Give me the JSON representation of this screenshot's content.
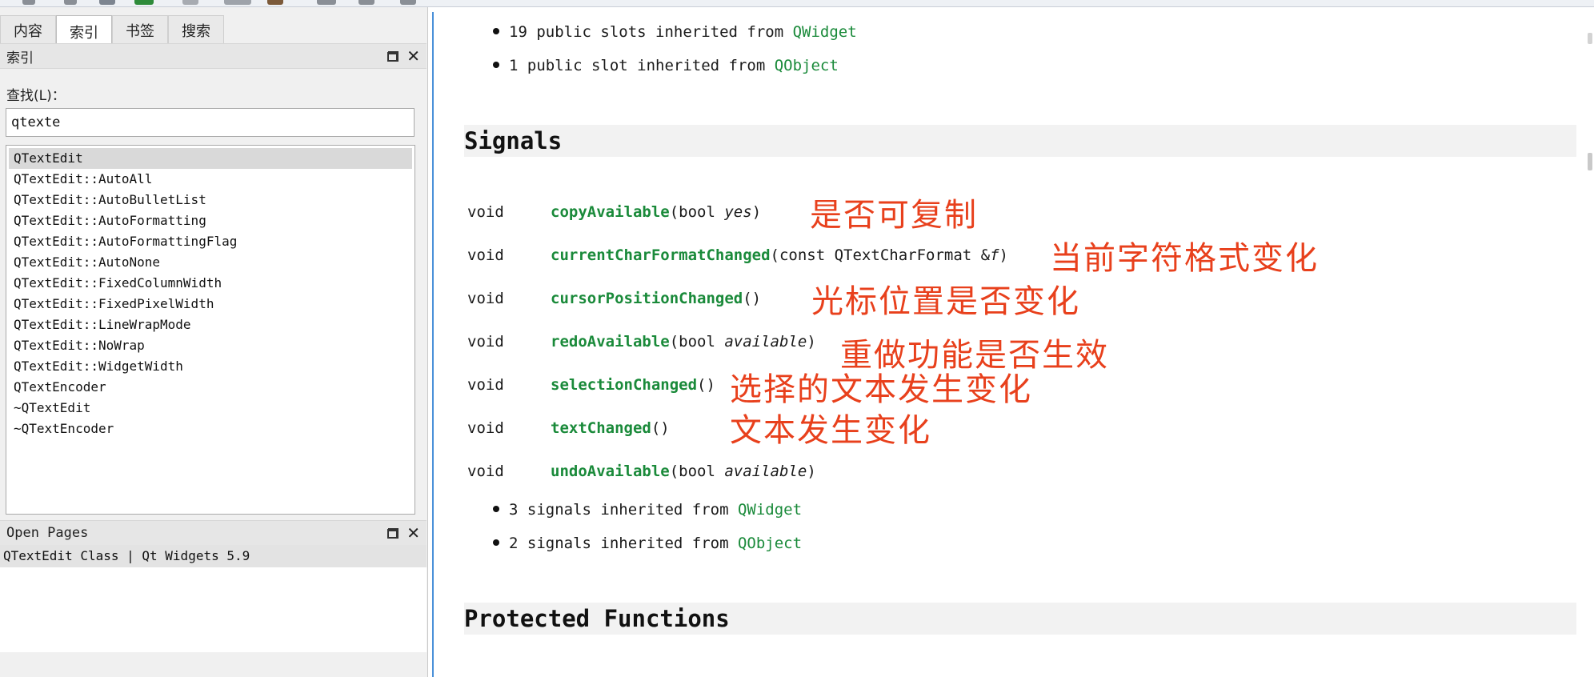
{
  "toolbar": {
    "icons": [
      "back-icon",
      "forward-icon",
      "home-icon",
      "sync-icon",
      "bookmark-icon",
      "print-icon",
      "zoom-in-icon",
      "zoom-out-icon",
      "zoom-reset-icon"
    ]
  },
  "left": {
    "tabs": [
      "内容",
      "索引",
      "书签",
      "搜索"
    ],
    "active_tab": "索引",
    "index_dock_title": "索引",
    "find_label": "查找(L)：",
    "search_value": "qtexte",
    "index_items": [
      "QTextEdit",
      "QTextEdit::AutoAll",
      "QTextEdit::AutoBulletList",
      "QTextEdit::AutoFormatting",
      "QTextEdit::AutoFormattingFlag",
      "QTextEdit::AutoNone",
      "QTextEdit::FixedColumnWidth",
      "QTextEdit::FixedPixelWidth",
      "QTextEdit::LineWrapMode",
      "QTextEdit::NoWrap",
      "QTextEdit::WidgetWidth",
      "QTextEncoder",
      "~QTextEdit",
      "~QTextEncoder"
    ],
    "selected_index": 0,
    "open_pages_title": "Open Pages",
    "open_page_item": "QTextEdit Class | Qt Widgets 5.9"
  },
  "content": {
    "slots_inherited": [
      {
        "text": "19 public slots inherited from ",
        "link": "QWidget"
      },
      {
        "text": "1 public slot inherited from ",
        "link": "QObject"
      }
    ],
    "signals_heading": "Signals",
    "signals": [
      {
        "ret": "void",
        "name": "copyAvailable",
        "pre": "(bool ",
        "arg": "yes",
        "post": ")"
      },
      {
        "ret": "void",
        "name": "currentCharFormatChanged",
        "pre": "(const QTextCharFormat &",
        "arg": "f",
        "post": ")"
      },
      {
        "ret": "void",
        "name": "cursorPositionChanged",
        "pre": "()",
        "arg": "",
        "post": ""
      },
      {
        "ret": "void",
        "name": "redoAvailable",
        "pre": "(bool ",
        "arg": "available",
        "post": ")"
      },
      {
        "ret": "void",
        "name": "selectionChanged",
        "pre": "()",
        "arg": "",
        "post": ""
      },
      {
        "ret": "void",
        "name": "textChanged",
        "pre": "()",
        "arg": "",
        "post": ""
      },
      {
        "ret": "void",
        "name": "undoAvailable",
        "pre": "(bool ",
        "arg": "available",
        "post": ")"
      }
    ],
    "signals_inherited": [
      {
        "text": "3 signals inherited from ",
        "link": "QWidget"
      },
      {
        "text": "2 signals inherited from ",
        "link": "QObject"
      }
    ],
    "protected_heading": "Protected Functions",
    "annotations": [
      "是否可复制",
      "当前字符格式变化",
      "光标位置是否变化",
      "重做功能是否生效",
      "选择的文本发生变化",
      "文本发生变化"
    ],
    "annotation_color": "#e8401c",
    "link_color": "#1a8a3a"
  }
}
